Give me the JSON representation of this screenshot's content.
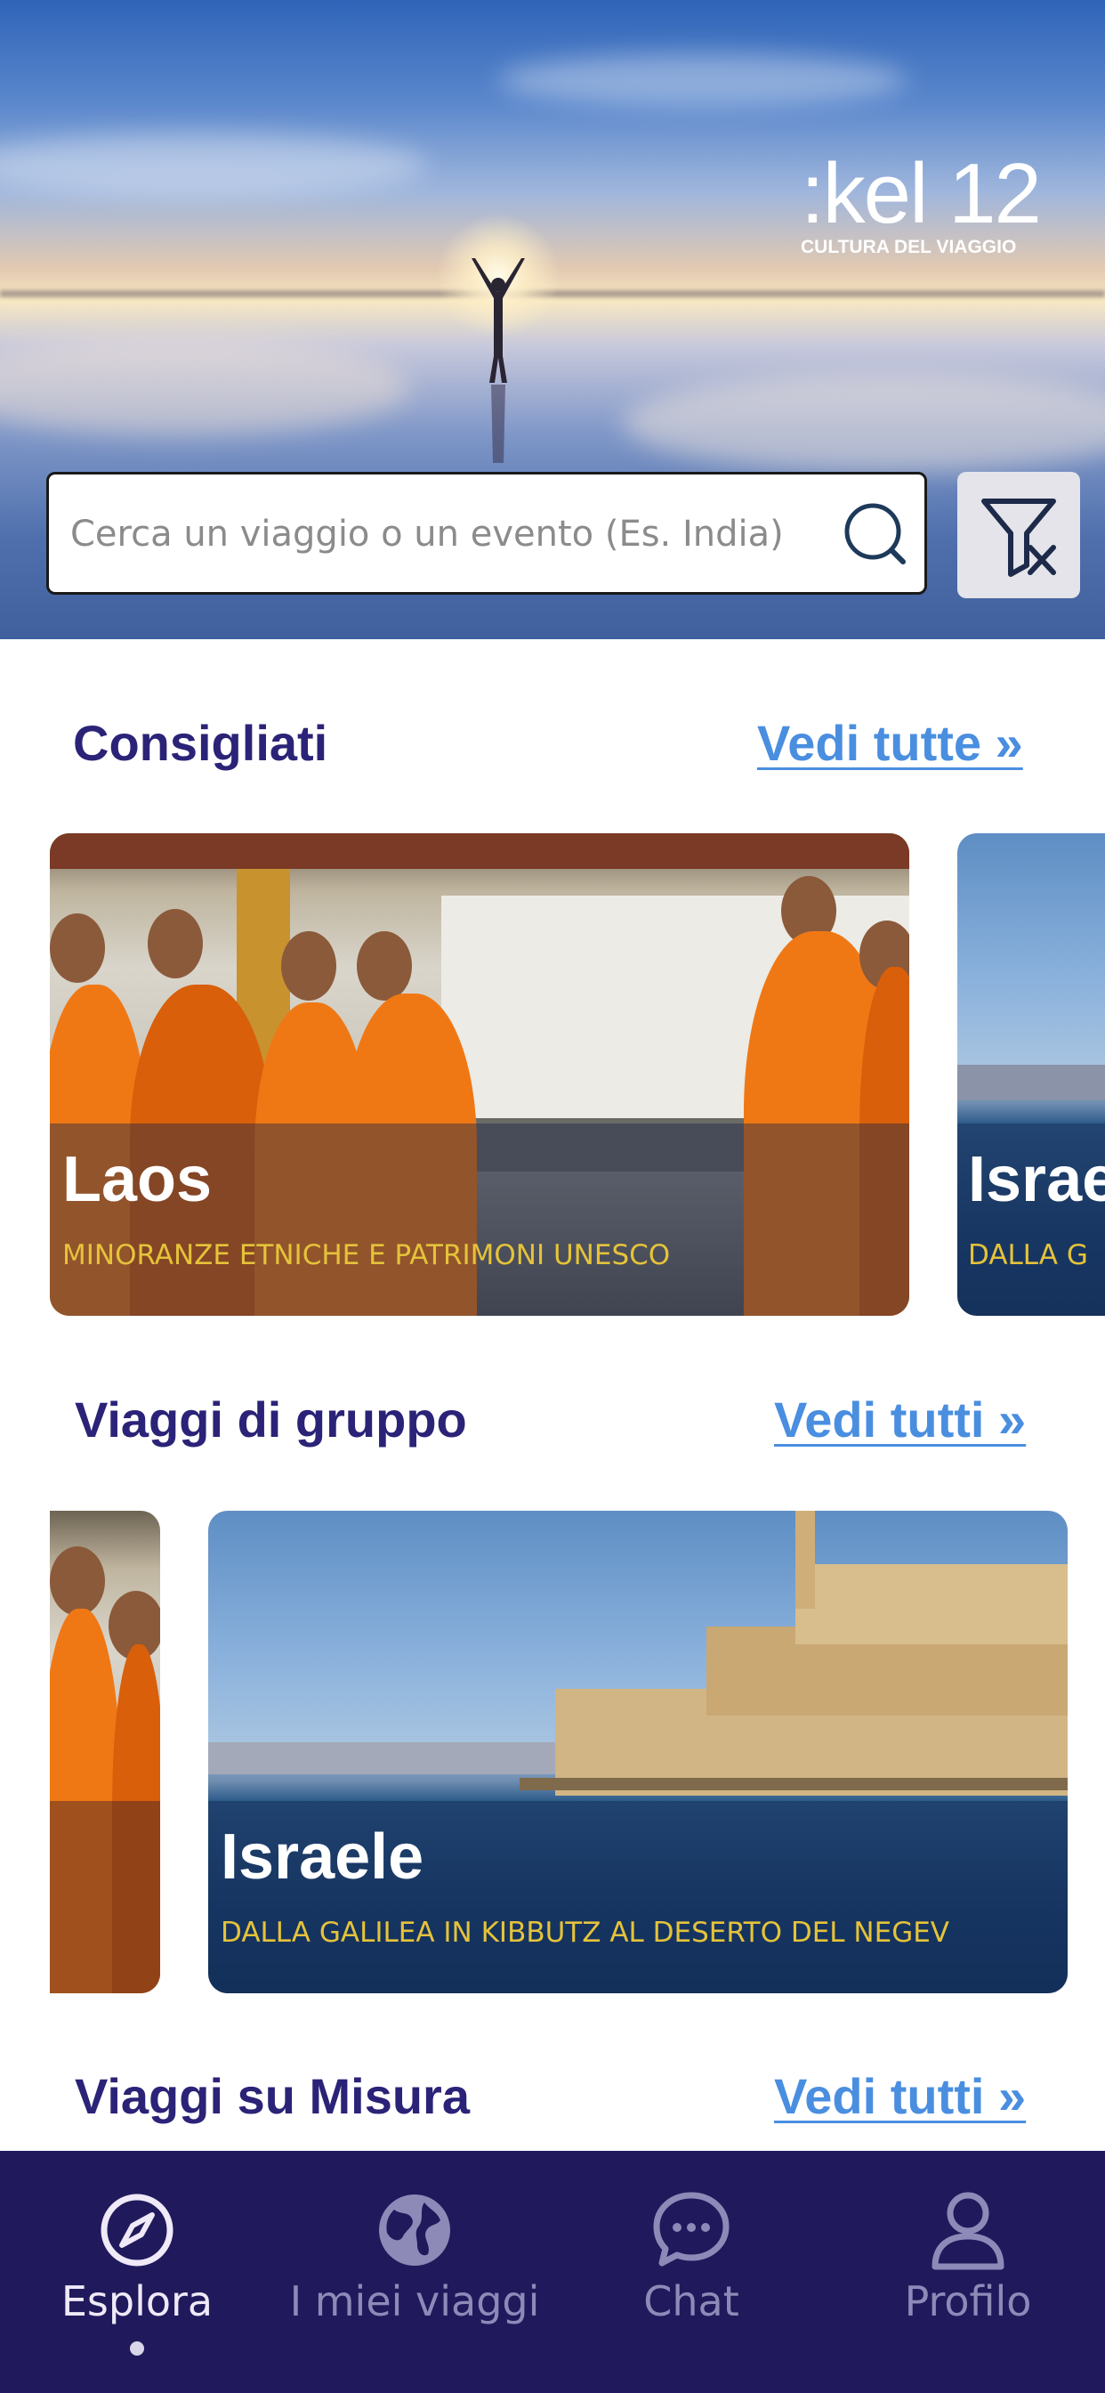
{
  "brand": {
    "logo_text": ":kel 12",
    "logo_subtitle": "CULTURA DEL VIAGGIO"
  },
  "search": {
    "placeholder": "Cerca un viaggio o un evento (Es. India)",
    "value": "",
    "icon": "search-icon"
  },
  "filter": {
    "icon": "filter-clear-icon"
  },
  "sections": {
    "consigliati": {
      "title": "Consigliati",
      "see_all": "Vedi tutte »",
      "cards": [
        {
          "title": "Laos",
          "subtitle": "MINORANZE ETNICHE E PATRIMONI UNESCO"
        },
        {
          "title": "Israe",
          "subtitle": "DALLA G"
        }
      ]
    },
    "gruppo": {
      "title": "Viaggi di gruppo",
      "see_all": "Vedi tutti »",
      "cards": [
        {
          "title": "Israele",
          "subtitle": "DALLA GALILEA IN KIBBUTZ AL DESERTO DEL NEGEV"
        }
      ]
    },
    "misura": {
      "title": "Viaggi su Misura",
      "see_all": "Vedi tutti »"
    }
  },
  "nav": {
    "items": [
      {
        "label": "Esplora",
        "icon": "compass-icon",
        "active": true
      },
      {
        "label": "I miei viaggi",
        "icon": "globe-icon",
        "active": false
      },
      {
        "label": "Chat",
        "icon": "chat-bubble-icon",
        "active": false
      },
      {
        "label": "Profilo",
        "icon": "user-icon",
        "active": false
      }
    ]
  },
  "colors": {
    "brand_navy": "#201a5c",
    "title_purple": "#2b2377",
    "link_blue": "#4a8ee0",
    "subtitle_gold": "#e5c33a"
  }
}
